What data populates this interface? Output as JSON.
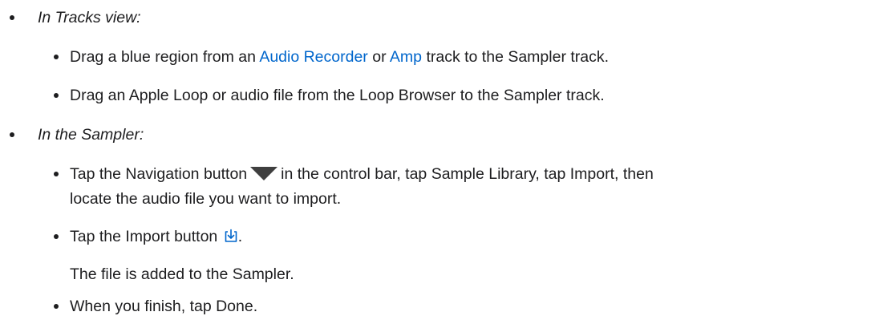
{
  "list": {
    "tracks": {
      "heading": "In Tracks view:",
      "item1": {
        "before": "Drag a blue region from an ",
        "link1": "Audio Recorder",
        "middle": " or ",
        "link2": "Amp",
        "after": " track to the Sampler track."
      },
      "item2": "Drag an Apple Loop or audio file from the Loop Browser to the Sampler track."
    },
    "sampler": {
      "heading": "In the Sampler:",
      "item1": {
        "before": "Tap the Navigation button",
        "after": "in the control bar, tap Sample Library, tap Import, then",
        "line2": "locate the audio file you want to import."
      },
      "item2": {
        "before": "Tap the Import button",
        "after": ".",
        "result": "The file is added to the Sampler."
      },
      "item3": "When you finish, tap Done."
    }
  },
  "icons": {
    "navigation": "navigation-triangle-icon",
    "import": "import-icon"
  },
  "colors": {
    "text": "#1d1d1f",
    "link": "#0066cc",
    "icon_dark": "#3f3f3f"
  }
}
